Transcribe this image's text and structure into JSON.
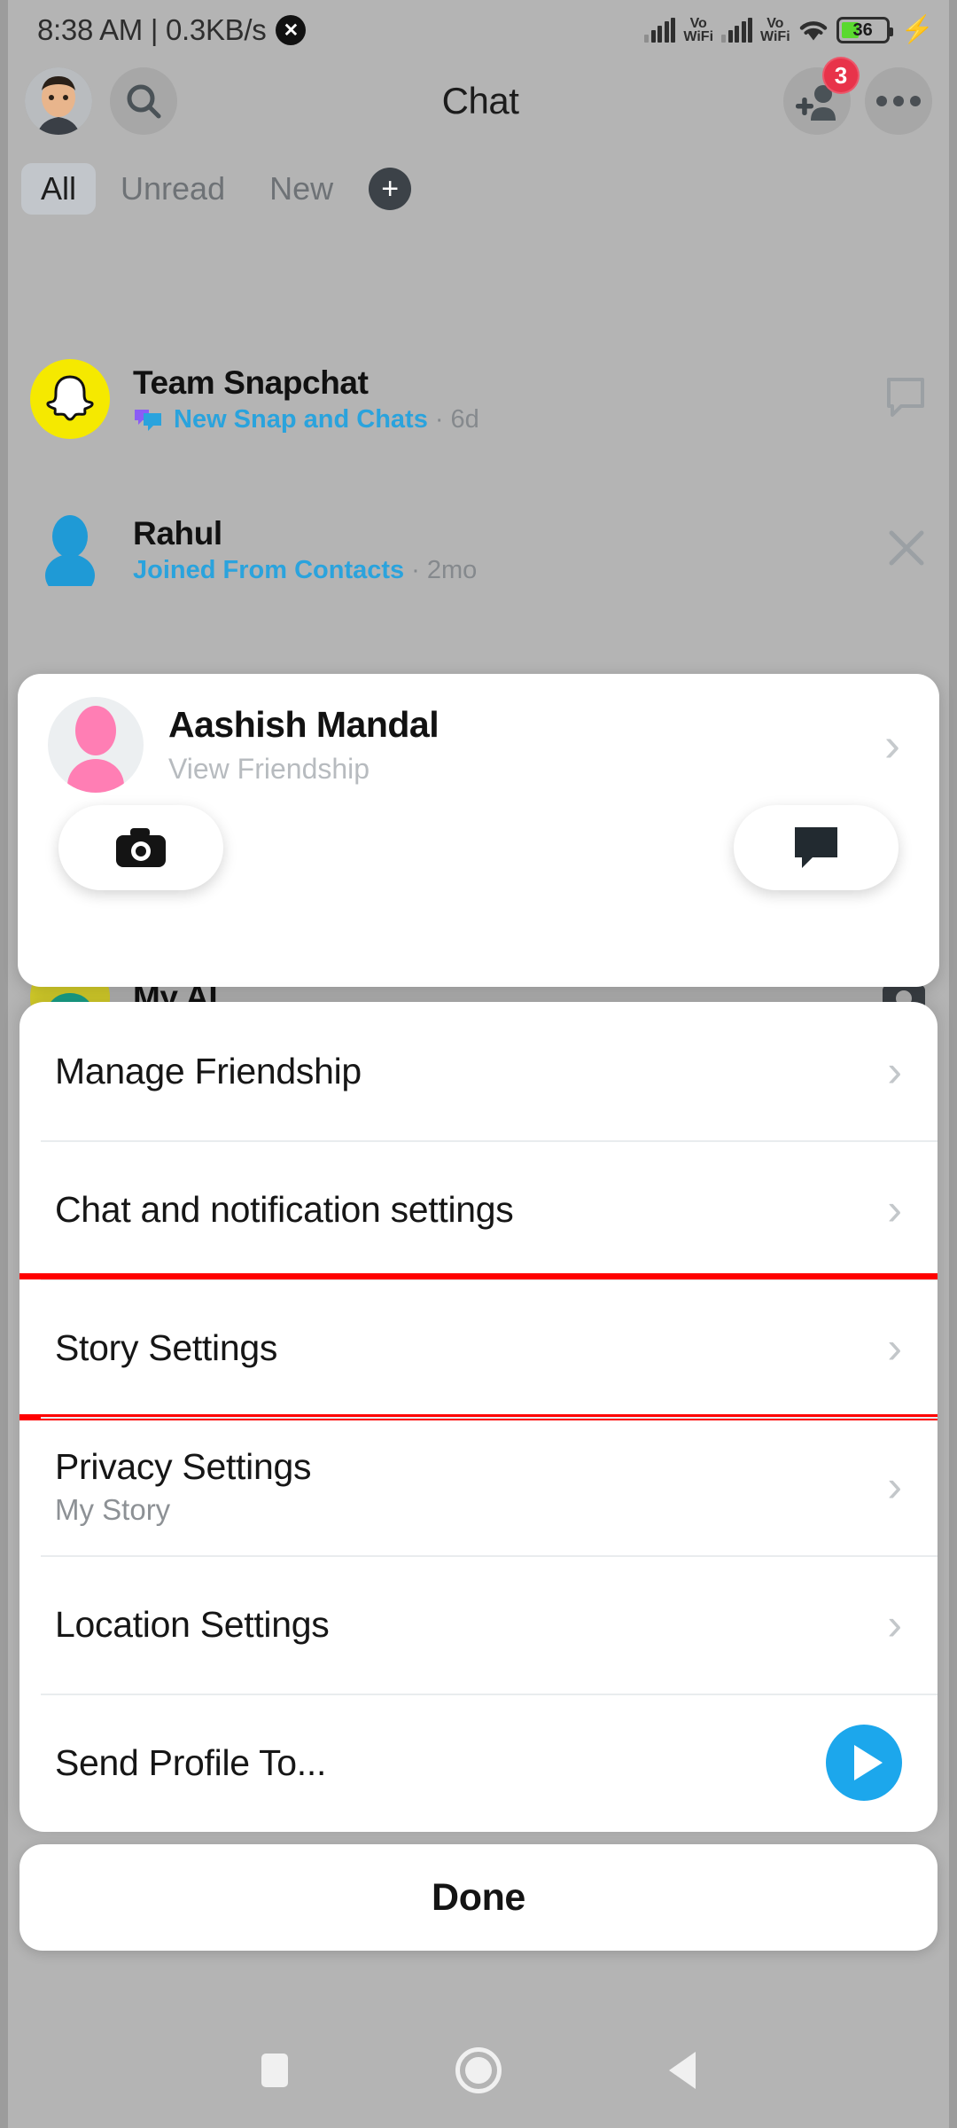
{
  "status_bar": {
    "clock": "8:38 AM | 0.3KB/s",
    "close_icon": "✕",
    "network_1": "Vo",
    "network_1b": "WiFi",
    "network_2": "Vo",
    "network_2b": "WiFi",
    "battery_level": "36",
    "charging_icon": "⚡"
  },
  "header": {
    "title": "Chat",
    "profile_icon": "bitmoji-avatar",
    "search_icon": "search-icon",
    "add_friend_icon": "add-friend-icon",
    "add_friend_badge": "3",
    "more_icon": "more-options-icon"
  },
  "tabs": {
    "items": [
      {
        "label": "All",
        "active": true
      },
      {
        "label": "Unread",
        "active": false
      },
      {
        "label": "New",
        "active": false
      }
    ],
    "new_plus": "+"
  },
  "chat_list": [
    {
      "name": "Team Snapchat",
      "status": "New Snap and Chats",
      "time": "6d",
      "avatar": "snapchat-ghost-avatar",
      "action_icon": "chat-bubble-icon"
    },
    {
      "name": "Rahul",
      "status": "Joined From Contacts",
      "time": "2mo",
      "avatar": "person-avatar-blue",
      "action_icon": "close-icon"
    },
    {
      "name": "My AI",
      "status": "",
      "time": "",
      "avatar": "my-ai-avatar",
      "action_icon": "camera-icon"
    }
  ],
  "friend_card": {
    "name": "Aashish Mandal",
    "subtitle": "View Friendship",
    "chevron": "›",
    "camera_icon": "camera-icon",
    "chat_icon": "chat-bubble-icon"
  },
  "menu": {
    "items": [
      {
        "label": "Manage Friendship",
        "sub": "",
        "accessory": "chevron",
        "highlighted": false
      },
      {
        "label": "Chat and notification settings",
        "sub": "",
        "accessory": "chevron",
        "highlighted": false
      },
      {
        "label": "Story Settings",
        "sub": "",
        "accessory": "chevron",
        "highlighted": true
      },
      {
        "label": "Privacy Settings",
        "sub": "My Story",
        "accessory": "chevron",
        "highlighted": false
      },
      {
        "label": "Location Settings",
        "sub": "",
        "accessory": "chevron",
        "highlighted": false
      },
      {
        "label": "Send Profile To...",
        "sub": "",
        "accessory": "send",
        "highlighted": false
      }
    ],
    "chevron": "›"
  },
  "done_button": {
    "label": "Done"
  },
  "nav_bar": {
    "recents_icon": "recents-square-icon",
    "home_icon": "home-circle-icon",
    "back_icon": "back-triangle-icon"
  },
  "colors": {
    "accent_blue": "#1ca7ec",
    "snap_yellow": "#f5e900",
    "badge_red": "#e8334a",
    "highlight_red": "#ff0000",
    "battery_green": "#5ad92f",
    "link_blue": "#2aa3dd"
  }
}
